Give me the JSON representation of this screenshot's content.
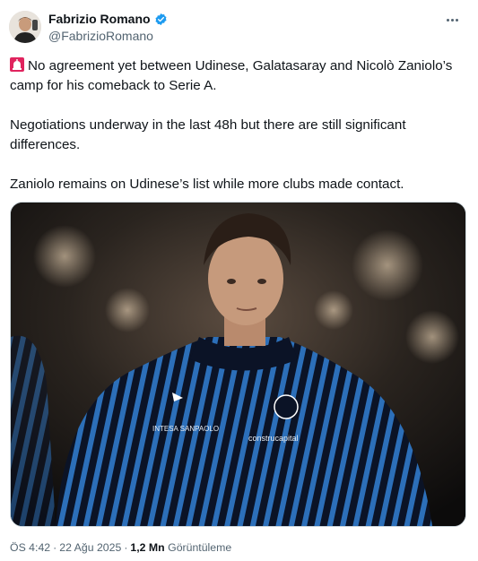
{
  "author": {
    "display_name": "Fabrizio Romano",
    "handle": "@FabrizioRomano",
    "verified_color": "#1d9bf0"
  },
  "tweet": {
    "paragraph1_emoji": "siren-icon",
    "paragraph1": "No agreement yet between Udinese, Galatasaray and Nicolò Zaniolo’s camp for his comeback to Serie A.",
    "paragraph2": "Negotiations underway in the last 48h but there are still significant differences.",
    "paragraph3": "Zaniolo remains on Udinese’s list while more clubs made contact."
  },
  "media": {
    "jacket_text_left": "INTESA SANPAOLO",
    "jacket_text_right": "construcapital",
    "kit_colors": [
      "#14213d",
      "#2b6fb8",
      "#0a0f1d"
    ]
  },
  "meta": {
    "time": "ÖS 4:42",
    "date": "22 Ağu 2025",
    "views_count": "1,2 Mn",
    "views_label": "Görüntüleme"
  },
  "more_icon": "more-options-icon"
}
